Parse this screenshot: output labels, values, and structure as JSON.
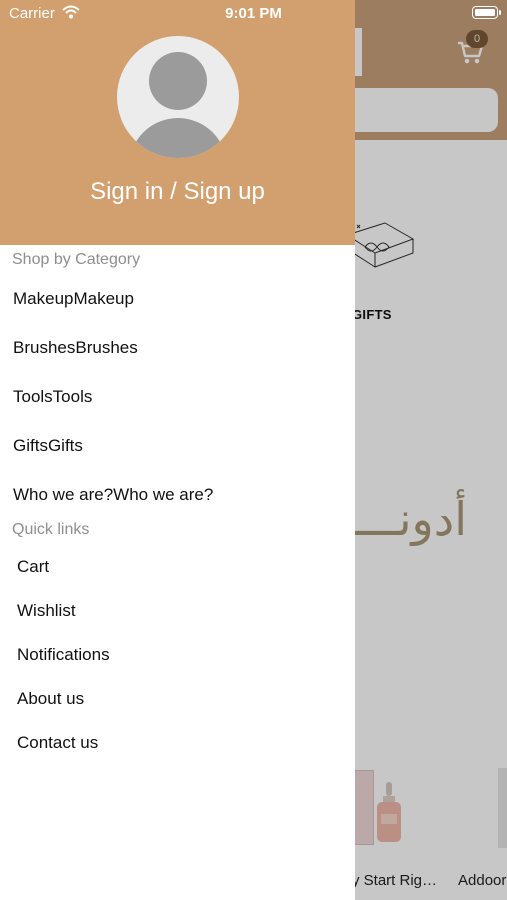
{
  "status_bar": {
    "carrier": "Carrier",
    "time": "9:01 PM"
  },
  "drawer": {
    "background_color": "#d29f6f",
    "sign_in_label": "Sign in / Sign up",
    "shop_by_category_title": "Shop by Category",
    "categories": [
      "MakeupMakeup",
      "BrushesBrushes",
      "ToolsTools",
      "GiftsGifts",
      "Who we are?Who we are?"
    ],
    "quick_links_title": "Quick links",
    "quick_links": [
      "Cart",
      "Wishlist",
      "Notifications",
      "About us",
      "Contact us"
    ]
  },
  "background_app": {
    "cart_count": "0",
    "gifts_label": "GIFTS",
    "brand_arabic": "أدونــــ",
    "products": [
      "y Start Rig…",
      "Addoor"
    ]
  },
  "icons": [
    "wifi-icon",
    "battery-icon",
    "cart-icon",
    "gift-box-icon",
    "avatar-placeholder-icon"
  ]
}
